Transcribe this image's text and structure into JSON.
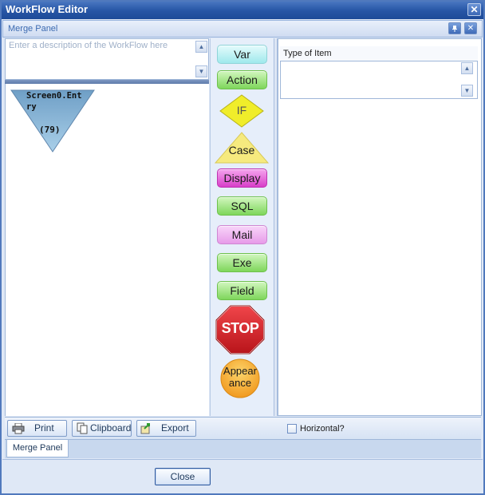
{
  "window": {
    "title": "WorkFlow Editor",
    "close_glyph": "✕"
  },
  "panel_header": {
    "title": "Merge Panel",
    "pin_icon": "pin-icon",
    "close_icon": "close-icon"
  },
  "description": {
    "placeholder": "Enter a description of the WorkFlow here",
    "value": ""
  },
  "canvas": {
    "node": {
      "label": "Screen0.Entry",
      "count": "(79)",
      "color": "#7aaed6"
    }
  },
  "palette": {
    "items": [
      {
        "label": "Var",
        "color": "#a9eef0"
      },
      {
        "label": "Action",
        "color": "#8ee06a"
      },
      {
        "label": "IF",
        "color": "#f2f028"
      },
      {
        "label": "Case",
        "color": "#f5e97a"
      },
      {
        "label": "Display",
        "color": "#e04ad0"
      },
      {
        "label": "SQL",
        "color": "#8ee06a"
      },
      {
        "label": "Mail",
        "color": "#e9a2ec"
      },
      {
        "label": "Exe",
        "color": "#8ee06a"
      },
      {
        "label": "Field",
        "color": "#8ee06a"
      },
      {
        "label": "STOP",
        "color": "#d8242a"
      },
      {
        "label": "Appearance",
        "color": "#f6a91e"
      }
    ]
  },
  "properties": {
    "type_label": "Type of Item",
    "type_value": ""
  },
  "toolbar": {
    "print": "Print",
    "clipboard": "Clipboard",
    "export": "Export",
    "horizontal_label": "Horizontal?",
    "horizontal_checked": false
  },
  "tabs": [
    {
      "label": "Merge Panel",
      "active": true
    }
  ],
  "footer": {
    "close": "Close"
  }
}
